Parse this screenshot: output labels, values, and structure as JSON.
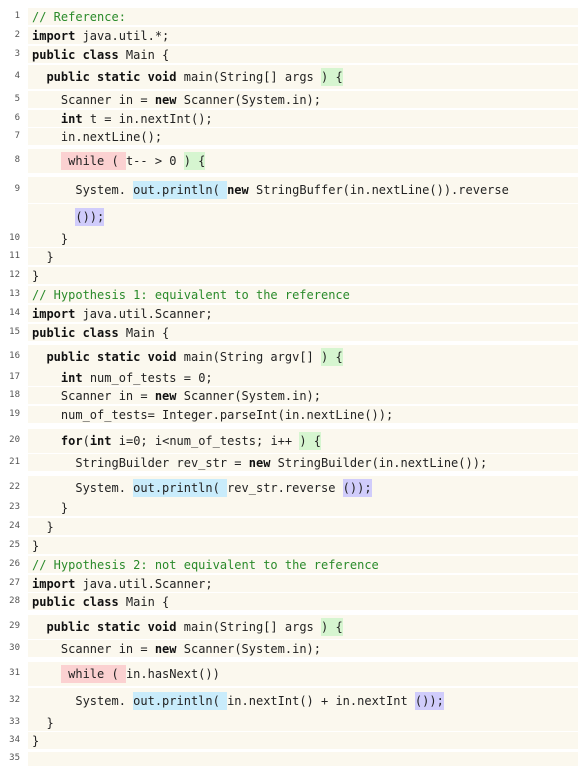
{
  "colors": {
    "background": "#fbf8ee",
    "comment": "#2a8a2a",
    "highlight_red": "#fbd1d1",
    "highlight_green": "#d6f5d0",
    "highlight_blue": "#c9ecfb",
    "highlight_purple": "#d0ccfb"
  },
  "lines": [
    {
      "num": "1",
      "segs": [
        {
          "t": "// Reference:",
          "c": "cm"
        }
      ]
    },
    {
      "num": "2",
      "segs": [
        {
          "t": "import",
          "c": "kw"
        },
        {
          "t": " java.util.*;"
        }
      ]
    },
    {
      "num": "3",
      "segs": [
        {
          "t": "public class",
          "c": "kw"
        },
        {
          "t": " Main {"
        }
      ]
    },
    {
      "num": "4",
      "segs": [
        {
          "t": "  "
        },
        {
          "t": "public static void",
          "c": "kw"
        },
        {
          "t": " main(String[] args "
        },
        {
          "t": ") {",
          "h": "green"
        }
      ]
    },
    {
      "num": "5",
      "segs": [
        {
          "t": "    Scanner in = "
        },
        {
          "t": "new",
          "c": "kw"
        },
        {
          "t": " Scanner(System.in);"
        }
      ]
    },
    {
      "num": "6",
      "segs": [
        {
          "t": "    "
        },
        {
          "t": "int",
          "c": "kw"
        },
        {
          "t": " t = in.nextInt();"
        }
      ]
    },
    {
      "num": "7",
      "segs": [
        {
          "t": "    in.nextLine();"
        }
      ]
    },
    {
      "num": "8",
      "segs": [
        {
          "t": "    "
        },
        {
          "t": " while ( ",
          "h": "red"
        },
        {
          "t": "t-- > 0 "
        },
        {
          "t": ") {",
          "h": "green"
        }
      ]
    },
    {
      "num": "9",
      "segs": [
        {
          "t": "      System. "
        },
        {
          "t": "out.println( ",
          "h": "blue"
        },
        {
          "t": "new",
          "c": "kw"
        },
        {
          "t": " StringBuffer(in.nextLine()).reverse"
        }
      ]
    },
    {
      "num": "",
      "segs": [
        {
          "t": "      "
        },
        {
          "t": "());",
          "h": "purple"
        }
      ]
    },
    {
      "num": "10",
      "segs": [
        {
          "t": "    }"
        }
      ]
    },
    {
      "num": "11",
      "segs": [
        {
          "t": "  }"
        }
      ]
    },
    {
      "num": "12",
      "segs": [
        {
          "t": "}"
        }
      ]
    },
    {
      "num": "13",
      "segs": [
        {
          "t": "// Hypothesis 1: equivalent to the reference",
          "c": "cm"
        }
      ]
    },
    {
      "num": "14",
      "segs": [
        {
          "t": "import",
          "c": "kw"
        },
        {
          "t": " java.util.Scanner;"
        }
      ]
    },
    {
      "num": "15",
      "segs": [
        {
          "t": "public class",
          "c": "kw"
        },
        {
          "t": " Main {"
        }
      ]
    },
    {
      "num": "16",
      "segs": [
        {
          "t": "  "
        },
        {
          "t": "public static void",
          "c": "kw"
        },
        {
          "t": " main(String argv[] "
        },
        {
          "t": ") {",
          "h": "green"
        }
      ]
    },
    {
      "num": "17",
      "segs": [
        {
          "t": "    "
        },
        {
          "t": "int",
          "c": "kw"
        },
        {
          "t": " num_of_tests = 0;"
        }
      ]
    },
    {
      "num": "18",
      "segs": [
        {
          "t": "    Scanner in = "
        },
        {
          "t": "new",
          "c": "kw"
        },
        {
          "t": " Scanner(System.in);"
        }
      ]
    },
    {
      "num": "19",
      "segs": [
        {
          "t": "    num_of_tests= Integer.parseInt(in.nextLine());"
        }
      ]
    },
    {
      "num": "20",
      "segs": [
        {
          "t": "    "
        },
        {
          "t": "for",
          "c": "kw"
        },
        {
          "t": "("
        },
        {
          "t": "int",
          "c": "kw"
        },
        {
          "t": " i=0; i<num_of_tests; i++ "
        },
        {
          "t": ") {",
          "h": "green"
        }
      ]
    },
    {
      "num": "21",
      "segs": [
        {
          "t": "      StringBuilder rev_str = "
        },
        {
          "t": "new",
          "c": "kw"
        },
        {
          "t": " StringBuilder(in.nextLine());"
        }
      ]
    },
    {
      "num": "22",
      "segs": [
        {
          "t": "      System. "
        },
        {
          "t": "out.println( ",
          "h": "blue"
        },
        {
          "t": "rev_str.reverse "
        },
        {
          "t": "());",
          "h": "purple"
        }
      ]
    },
    {
      "num": "23",
      "segs": [
        {
          "t": "    }"
        }
      ]
    },
    {
      "num": "24",
      "segs": [
        {
          "t": "  }"
        }
      ]
    },
    {
      "num": "25",
      "segs": [
        {
          "t": "}"
        }
      ]
    },
    {
      "num": "26",
      "segs": [
        {
          "t": "// Hypothesis 2: not equivalent to the reference",
          "c": "cm"
        }
      ]
    },
    {
      "num": "27",
      "segs": [
        {
          "t": "import",
          "c": "kw"
        },
        {
          "t": " java.util.Scanner;"
        }
      ]
    },
    {
      "num": "28",
      "segs": [
        {
          "t": "public class",
          "c": "kw"
        },
        {
          "t": " Main {"
        }
      ]
    },
    {
      "num": "29",
      "segs": [
        {
          "t": "  "
        },
        {
          "t": "public static void",
          "c": "kw"
        },
        {
          "t": " main(String[] args "
        },
        {
          "t": ") {",
          "h": "green"
        }
      ]
    },
    {
      "num": "30",
      "segs": [
        {
          "t": "    Scanner in = "
        },
        {
          "t": "new",
          "c": "kw"
        },
        {
          "t": " Scanner(System.in);"
        }
      ]
    },
    {
      "num": "31",
      "segs": [
        {
          "t": "    "
        },
        {
          "t": " while ( ",
          "h": "red"
        },
        {
          "t": "in.hasNext())"
        }
      ]
    },
    {
      "num": "32",
      "segs": [
        {
          "t": "      System. "
        },
        {
          "t": "out.println( ",
          "h": "blue"
        },
        {
          "t": "in.nextInt() + in.nextInt "
        },
        {
          "t": "());",
          "h": "purple"
        }
      ]
    },
    {
      "num": "33",
      "segs": [
        {
          "t": "  }"
        }
      ]
    },
    {
      "num": "34",
      "segs": [
        {
          "t": "}"
        }
      ]
    },
    {
      "num": "35",
      "segs": []
    }
  ]
}
